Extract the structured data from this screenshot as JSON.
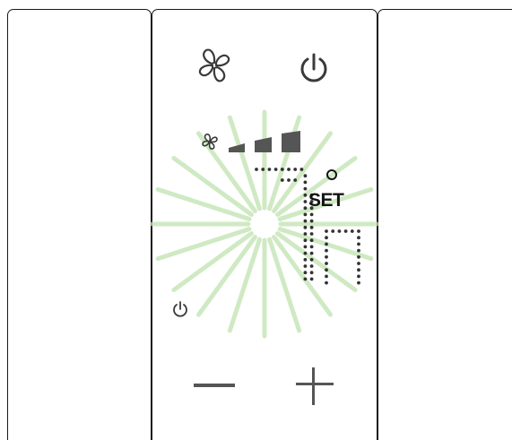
{
  "thermostat": {
    "set_label": "SET",
    "fan_speed_level": 3,
    "fan_speed_levels_total": 3,
    "display": {
      "digit_style": "dot-matrix",
      "visible_chars": [
        "7",
        "0"
      ],
      "glow_color": "#bfe3b0",
      "segment_color": "#333333"
    }
  },
  "buttons": {
    "fan": {
      "icon": "fan-icon"
    },
    "power": {
      "icon": "power-icon"
    },
    "minus": {
      "icon": "minus-icon"
    },
    "plus": {
      "icon": "plus-icon"
    }
  },
  "indicators": {
    "fan_speed_icon": "fan-small-icon",
    "standby_icon": "power-small-icon"
  },
  "colors": {
    "frame": "#1a1a1a",
    "icon": "#3a3a3a",
    "speed_bar": "#555555",
    "minus_plus": "#555555"
  }
}
